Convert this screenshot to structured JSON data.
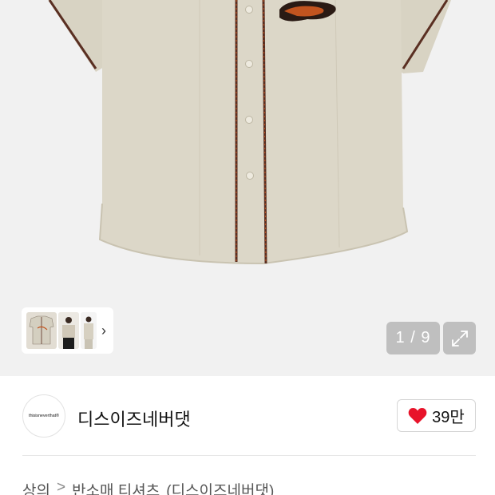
{
  "gallery": {
    "counter_text": "1 / 9",
    "shirt_color": "#d8d3c3",
    "piping_color": "#5a2f22",
    "piping_accent": "#c2541f",
    "thumbnail_arrow": "›",
    "expand_icon": "expand-icon"
  },
  "brand": {
    "logo_text": "thisisneverthat®",
    "name": "디스이즈네버댓",
    "like_icon": "heart-icon",
    "like_color": "#e8132a",
    "like_count": "39만"
  },
  "breadcrumb": {
    "items": [
      "상의",
      "반소매 티셔츠",
      "(디스이즈네버댓)"
    ],
    "separator": ">"
  }
}
